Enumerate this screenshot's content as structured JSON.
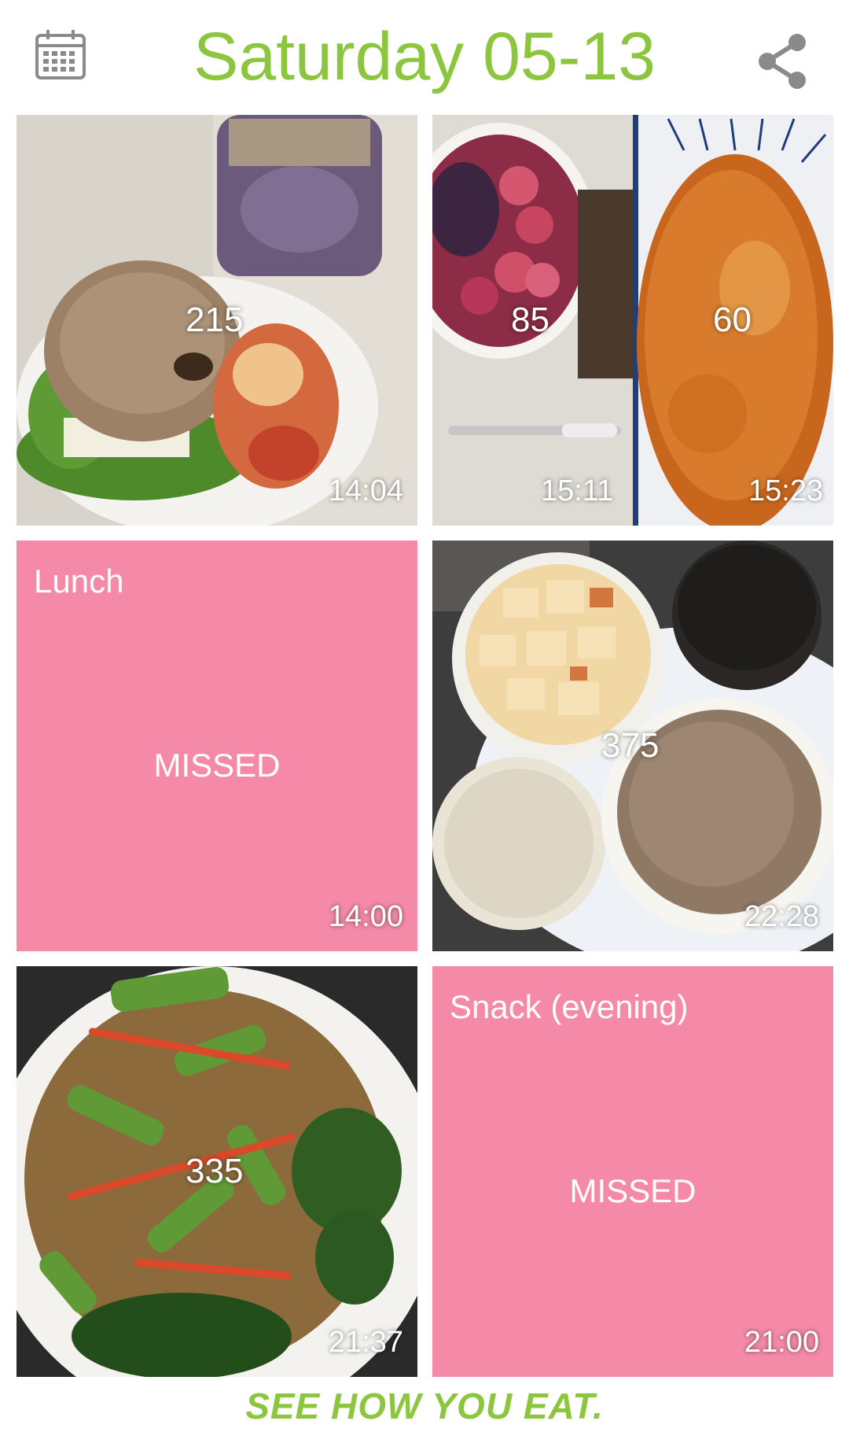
{
  "header": {
    "title": "Saturday 05-13",
    "left_icon": "calendar-icon",
    "right_icon": "share-icon",
    "accent_color": "#8cc63f"
  },
  "tiles": [
    {
      "type": "photo",
      "photos": [
        {
          "calories": "215"
        }
      ],
      "time": "14:04"
    },
    {
      "type": "photo",
      "photos": [
        {
          "calories": "85",
          "time": "15:11"
        },
        {
          "calories": "60",
          "time": "15:23"
        }
      ]
    },
    {
      "type": "missed",
      "meal": "Lunch",
      "status": "MISSED",
      "time": "14:00",
      "color": "#f48aa8"
    },
    {
      "type": "photo",
      "photos": [
        {
          "calories": "375"
        }
      ],
      "time": "22:28"
    },
    {
      "type": "photo",
      "photos": [
        {
          "calories": "335"
        }
      ],
      "time": "21:37"
    },
    {
      "type": "missed",
      "meal": "Snack (evening)",
      "status": "MISSED",
      "time": "21:00",
      "color": "#f48aa8"
    }
  ],
  "footer": {
    "tagline": "SEE HOW YOU EAT."
  }
}
